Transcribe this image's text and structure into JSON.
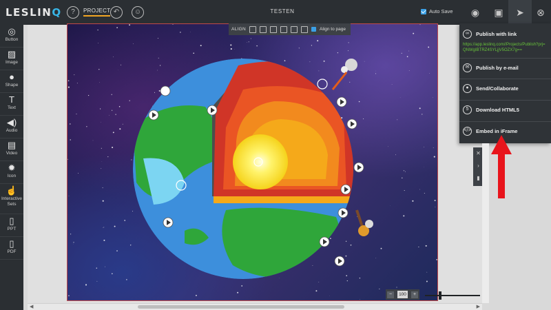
{
  "header": {
    "logo_left": "LESLIN",
    "logo_q": "Q",
    "project_tab": "PROJECT",
    "document_title": "TESTEN",
    "autosave_label": "Auto Save"
  },
  "toolbar": {
    "items": [
      {
        "label": "Button",
        "icon": "button-icon"
      },
      {
        "label": "Image",
        "icon": "image-icon"
      },
      {
        "label": "Shape",
        "icon": "shape-icon"
      },
      {
        "label": "Text",
        "icon": "text-icon"
      },
      {
        "label": "Audio",
        "icon": "audio-icon"
      },
      {
        "label": "Video",
        "icon": "video-icon"
      },
      {
        "label": "Icon",
        "icon": "icon-icon"
      },
      {
        "label": "Interactive",
        "label2": "Sets",
        "icon": "interactive-sets-icon"
      },
      {
        "label": "PPT",
        "icon": "ppt-icon"
      },
      {
        "label": "PDF",
        "icon": "pdf-icon"
      }
    ]
  },
  "align_bar": {
    "label": "ALIGN",
    "align_to_page": "Align to page"
  },
  "publish_menu": {
    "items": [
      {
        "label": "Publish with link",
        "icon": "link-icon"
      },
      {
        "label": "Publish by e-mail",
        "icon": "email-icon"
      },
      {
        "label": "Send/Collaborate",
        "icon": "person-icon"
      },
      {
        "label": "Download HTML5",
        "icon": "html5-icon"
      },
      {
        "label": "Embed in iFrame",
        "icon": "code-icon"
      }
    ],
    "link_url": "https://app.leslinq.com//Projects/Publish?prj=QNWgIBTRZ4SYLjjV5OZX7g=="
  },
  "zoom": {
    "value": "100",
    "minus": "−",
    "plus": "+"
  },
  "colors": {
    "accent": "#f2a623",
    "brand_blue": "#38b6e8",
    "link_green": "#67c23a",
    "arrow_red": "#e8141c"
  }
}
